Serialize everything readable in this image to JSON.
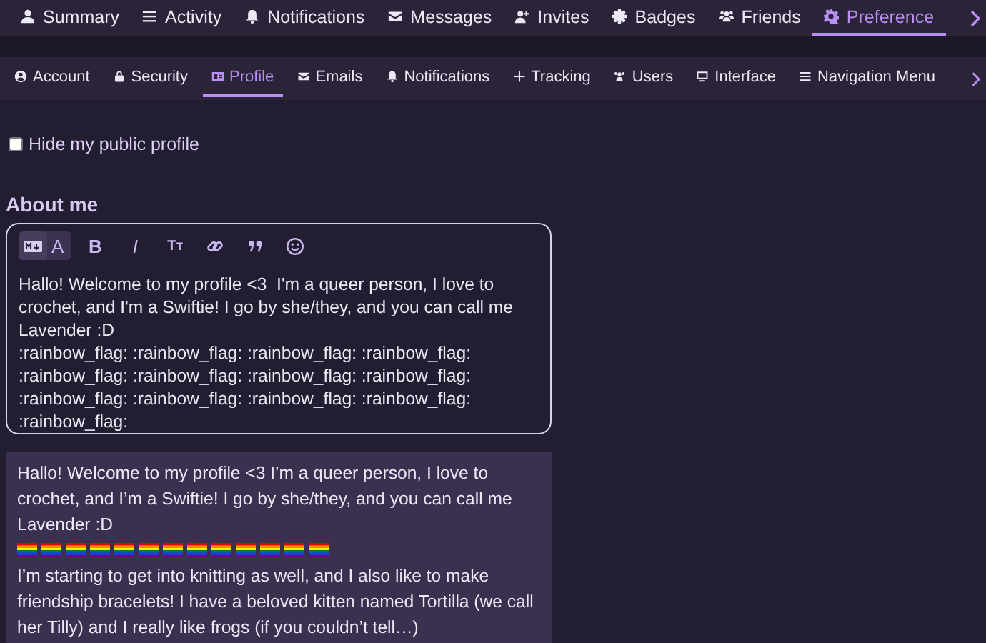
{
  "top_tabs": [
    {
      "label": "Summary",
      "selected": false
    },
    {
      "label": "Activity",
      "selected": false
    },
    {
      "label": "Notifications",
      "selected": false
    },
    {
      "label": "Messages",
      "selected": false
    },
    {
      "label": "Invites",
      "selected": false
    },
    {
      "label": "Badges",
      "selected": false
    },
    {
      "label": "Friends",
      "selected": false
    },
    {
      "label": "Preference",
      "selected": true
    }
  ],
  "sub_tabs": [
    {
      "label": "Account",
      "selected": false
    },
    {
      "label": "Security",
      "selected": false
    },
    {
      "label": "Profile",
      "selected": true
    },
    {
      "label": "Emails",
      "selected": false
    },
    {
      "label": "Notifications",
      "selected": false
    },
    {
      "label": "Tracking",
      "selected": false
    },
    {
      "label": "Users",
      "selected": false
    },
    {
      "label": "Interface",
      "selected": false
    },
    {
      "label": "Navigation Menu",
      "selected": false
    }
  ],
  "hide_profile": {
    "label": "Hide my public profile",
    "checked": false
  },
  "about": {
    "heading": "About me",
    "toolbar": [
      {
        "kind": "toggle",
        "label": "A"
      },
      {
        "kind": "text",
        "label": "B"
      },
      {
        "kind": "text",
        "label": "I"
      },
      {
        "kind": "text",
        "label": "Tт"
      },
      {
        "kind": "link"
      },
      {
        "kind": "quote"
      },
      {
        "kind": "emoji"
      }
    ],
    "value": "Hallo! Welcome to my profile <3  I'm a queer person, I love to crochet, and I'm a Swiftie! I go by she/they, and you can call me Lavender :D\n:rainbow_flag: :rainbow_flag: :rainbow_flag: :rainbow_flag:\n:rainbow_flag: :rainbow_flag: :rainbow_flag: :rainbow_flag:\n:rainbow_flag: :rainbow_flag: :rainbow_flag: :rainbow_flag:\n:rainbow_flag:",
    "preview": [
      {
        "kind": "text",
        "text": "Hallo! Welcome to my profile <3 I’m a queer person, I love to crochet, and I’m a Swiftie! I go by she/they, and you can call me Lavender :D"
      },
      {
        "kind": "flags",
        "flags": [
          {
            "kind": "rainbow"
          },
          {
            "kind": "rainbow"
          },
          {
            "kind": "rainbow"
          },
          {
            "kind": "rainbow"
          },
          {
            "kind": "rainbow"
          },
          {
            "kind": "rainbow"
          },
          {
            "kind": "rainbow"
          },
          {
            "kind": "rainbow"
          },
          {
            "kind": "rainbow"
          },
          {
            "kind": "rainbow"
          },
          {
            "kind": "rainbow"
          },
          {
            "kind": "rainbow"
          },
          {
            "kind": "rainbow"
          }
        ]
      },
      {
        "kind": "text",
        "text": "I’m starting to get into knitting as well, and I also like to make friendship bracelets! I have a beloved kitten named Tortilla (we call her Tilly) and I really like frogs (if you couldn’t tell…)"
      }
    ]
  }
}
